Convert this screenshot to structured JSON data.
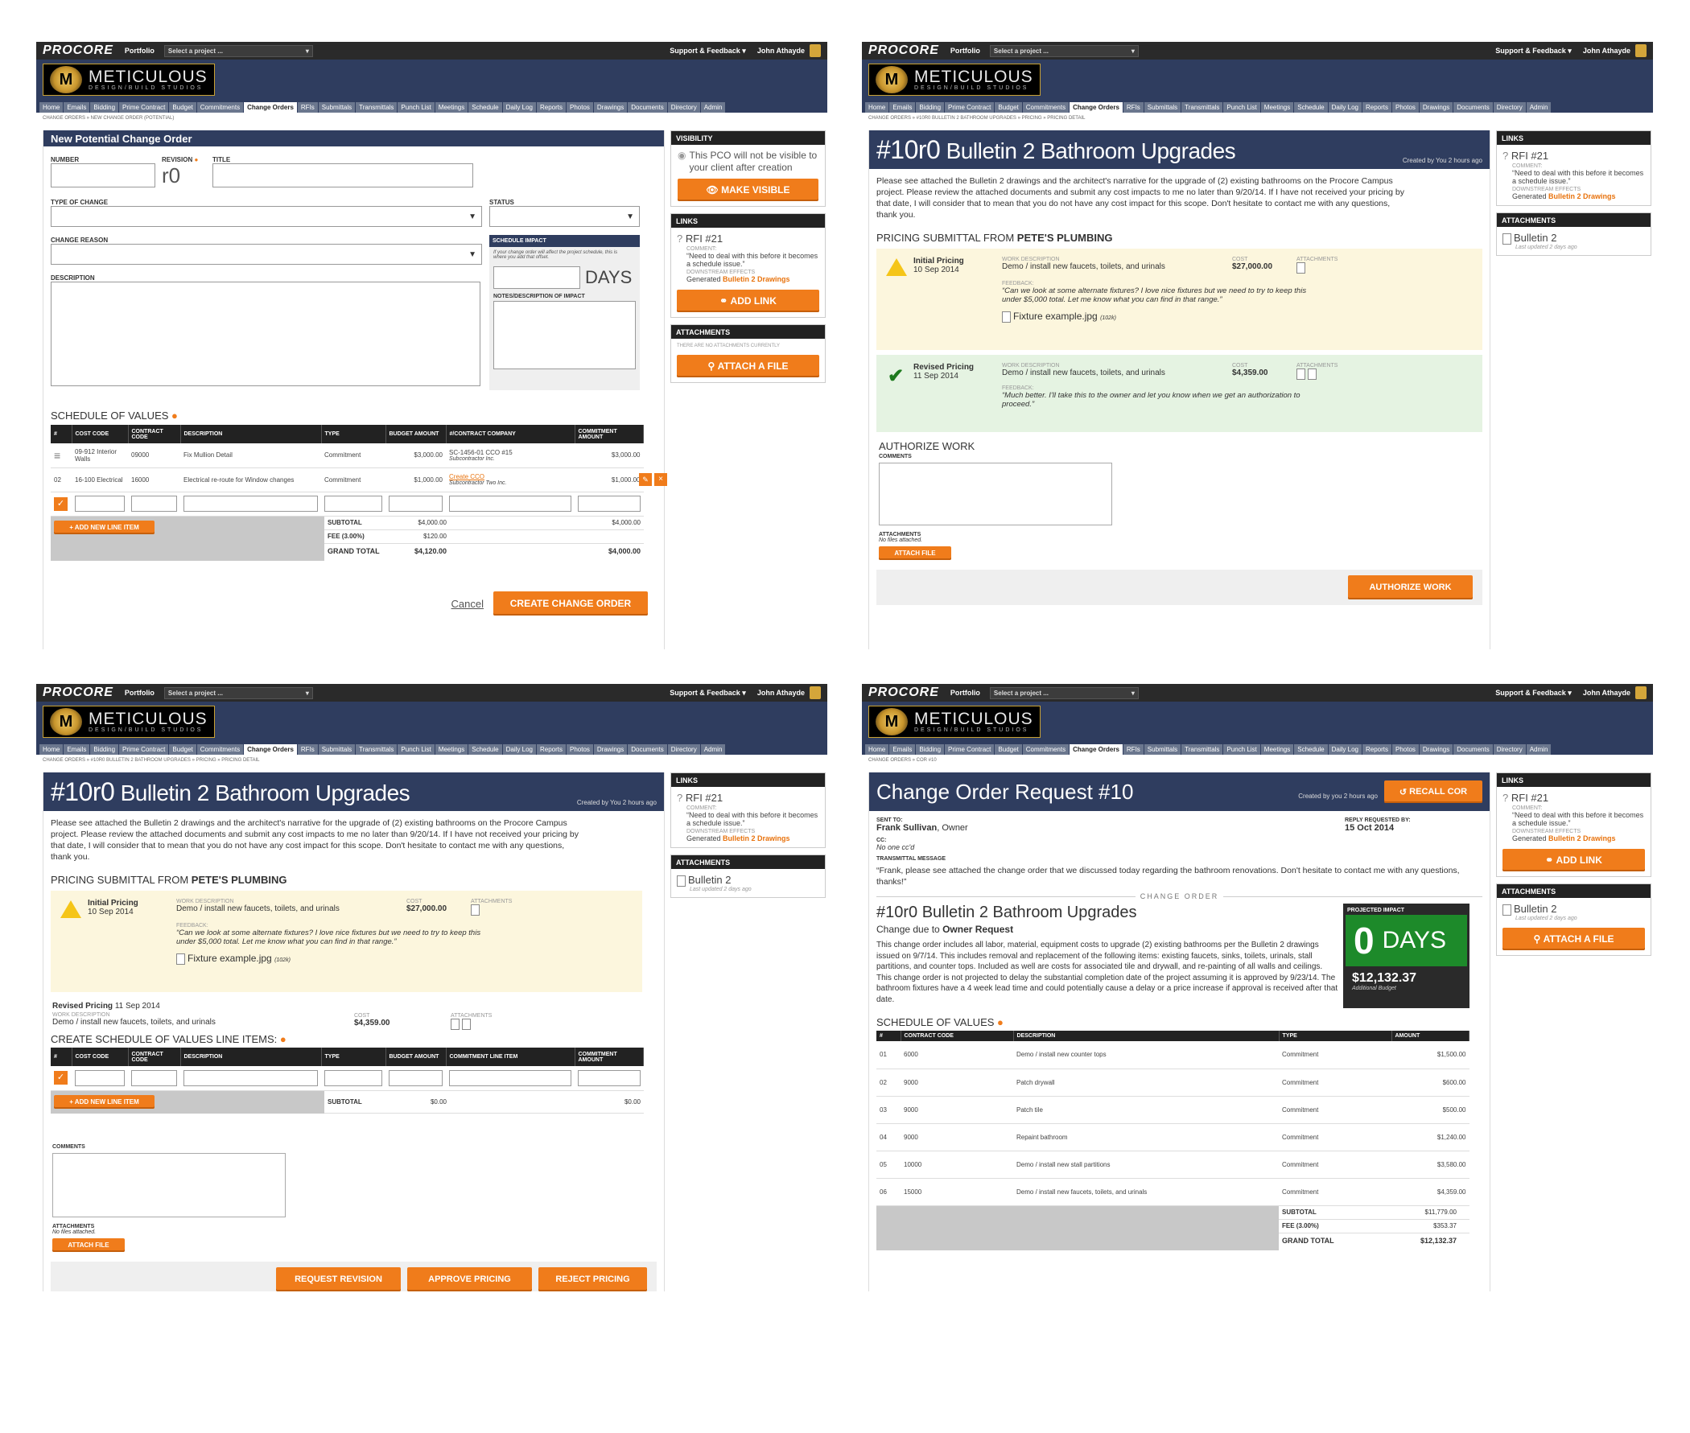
{
  "common": {
    "procore": "PROCORE",
    "portfolio": "Portfolio",
    "project_select": "Select a project ...",
    "support": "Support & Feedback ▾",
    "user": "John Athayde",
    "brand_name": "METICULOUS",
    "brand_sub": "DESIGN/BUILD STUDIOS",
    "nav": [
      "Home",
      "Emails",
      "Bidding",
      "Prime Contract",
      "Budget",
      "Commitments",
      "Change Orders",
      "RFIs",
      "Submittals",
      "Transmittals",
      "Punch List",
      "Meetings",
      "Schedule",
      "Daily Log",
      "Reports",
      "Photos",
      "Drawings",
      "Documents",
      "Directory",
      "Admin"
    ]
  },
  "s1": {
    "crumb": "CHANGE ORDERS » NEW CHANGE ORDER (POTENTIAL)",
    "title": "New Potential Change Order",
    "number_label": "NUMBER",
    "revision_label": "REVISION",
    "revision_value": "r0",
    "title_label": "TITLE",
    "type_label": "TYPE OF CHANGE",
    "status_label": "STATUS",
    "reason_label": "CHANGE REASON",
    "schedule_impact_label": "SCHEDULE IMPACT",
    "schedule_help": "If your change order will affect the project schedule, this is where you add that offset.",
    "days": "DAYS",
    "notes_label": "NOTES/DESCRIPTION OF IMPACT",
    "description_label": "DESCRIPTION",
    "sov_title": "SCHEDULE OF VALUES",
    "columns": [
      "#",
      "COST CODE",
      "CONTRACT CODE",
      "DESCRIPTION",
      "TYPE",
      "BUDGET AMOUNT",
      "#/CONTRACT COMPANY",
      "COMMITMENT AMOUNT"
    ],
    "rows": [
      {
        "num": "",
        "cost": "09-912 Interior Walls",
        "contract": "09000",
        "desc": "Fix Mullion Detail",
        "type": "Commitment",
        "budget": "$3,000.00",
        "company": "SC-1456-01 CCO #15",
        "company_sub": "Subcontractor Inc.",
        "commitment": "$3,000.00"
      },
      {
        "num": "02",
        "cost": "16-100 Electrical",
        "contract": "16000",
        "desc": "Electrical re-route for Window changes",
        "type": "Commitment",
        "budget": "$1,000.00",
        "company": "Create CCO",
        "company_sub": "Subcontractor Two Inc.",
        "commitment": "$1,000.00"
      }
    ],
    "add_line": "+ ADD NEW LINE ITEM",
    "subtotal_label": "SUBTOTAL",
    "subtotal": "$4,000.00",
    "fee_label": "FEE (3.00%)",
    "fee": "$120.00",
    "grand_label": "GRAND TOTAL",
    "grand": "$4,120.00",
    "commit_sub": "$4,000.00",
    "commit_grand": "$4,000.00",
    "cancel": "Cancel",
    "create": "CREATE CHANGE ORDER",
    "visibility_title": "VISIBILITY",
    "visibility_text": "This PCO will not be visible to your client after creation",
    "make_visible": "MAKE VISIBLE",
    "links_title": "LINKS",
    "rfi": "RFI #21",
    "comment_label": "COMMENT:",
    "comment": "“Need to deal with this before it becomes a schedule issue.”",
    "downstream": "DOWNSTREAM EFFECTS",
    "generated": "Generated",
    "bulletin_link": "Bulletin 2 Drawings",
    "add_link": "ADD LINK",
    "attachments_title": "ATTACHMENTS",
    "no_attach": "THERE ARE NO ATTACHMENTS CURRENTLY",
    "attach_file": "ATTACH A FILE"
  },
  "s2": {
    "crumb": "CHANGE ORDERS » #10R0 BULLETIN 2 BATHROOM UPGRADES » PRICING » PRICING DETAIL",
    "title_num": "#10r0",
    "title_text": "Bulletin 2 Bathroom Upgrades",
    "created": "Created by You 2 hours ago",
    "body": "Please see attached the Bulletin 2 drawings and the architect's narrative for the upgrade of (2) existing bathrooms on the Procore Campus project. Please review the attached documents and submit any cost impacts to me no later than 9/20/14. If I have not received your pricing by that date, I will consider that to mean that you do not have any cost impact for this scope. Don't hesitate to contact me with any questions, thank you.",
    "pricing_from": "PRICING SUBMITTAL FROM",
    "vendor": "PETE'S PLUMBING",
    "initial": "Initial Pricing",
    "initial_date": "10 Sep 2014",
    "work_label": "WORK DESCRIPTION",
    "work": "Demo / install new faucets, toilets, and urinals",
    "cost_label": "COST",
    "cost1": "$27,000.00",
    "attach_label": "ATTACHMENTS",
    "feedback_label": "FEEDBACK:",
    "feedback1": "“Can we look at some alternate fixtures? I love nice fixtures but we need to try to keep this under $5,000 total. Let me know what you can find in that range.”",
    "file1": "Fixture example.jpg",
    "file1_size": "(102k)",
    "revised": "Revised Pricing",
    "revised_date": "11 Sep 2014",
    "cost2": "$4,359.00",
    "feedback2": "“Much better. I'll take this to the owner and let you know when we get an authorization to proceed.”",
    "authorize_title": "AUTHORIZE WORK",
    "comments_label": "COMMENTS",
    "attachments_label": "ATTACHMENTS",
    "no_files": "No files attached.",
    "attach_file": "ATTACH FILE",
    "authorize_btn": "AUTHORIZE WORK",
    "links_title": "LINKS",
    "rfi": "RFI #21",
    "comment_label": "COMMENT:",
    "comment": "“Need to deal with this before it becomes a schedule issue.”",
    "downstream": "DOWNSTREAM EFFECTS",
    "generated": "Generated",
    "bulletin_link": "Bulletin 2 Drawings",
    "attachments_title": "ATTACHMENTS",
    "bulletin": "Bulletin 2",
    "last_updated": "Last updated 2 days ago"
  },
  "s3": {
    "crumb": "CHANGE ORDERS » #10R0 BULLETIN 2 BATHROOM UPGRADES » PRICING » PRICING DETAIL",
    "title_num": "#10r0",
    "title_text": "Bulletin 2 Bathroom Upgrades",
    "created": "Created by You 2 hours ago",
    "body": "Please see attached the Bulletin 2 drawings and the architect's narrative for the upgrade of (2) existing bathrooms on the Procore Campus project. Please review the attached documents and submit any cost impacts to me no later than 9/20/14. If I have not received your pricing by that date, I will consider that to mean that you do not have any cost impact for this scope. Don't hesitate to contact me with any questions, thank you.",
    "pricing_from": "PRICING SUBMITTAL FROM",
    "vendor": "PETE'S PLUMBING",
    "initial": "Initial Pricing",
    "initial_date": "10 Sep 2014",
    "work_label": "WORK DESCRIPTION",
    "work": "Demo / install new faucets, toilets, and urinals",
    "cost_label": "COST",
    "cost1": "$27,000.00",
    "attach_label": "ATTACHMENTS",
    "feedback_label": "FEEDBACK:",
    "feedback1": "“Can we look at some alternate fixtures? I love nice fixtures but we need to try to keep this under $5,000 total. Let me know what you can find in that range.”",
    "file1": "Fixture example.jpg",
    "file1_size": "(102k)",
    "revised": "Revised Pricing",
    "revised_date": "11 Sep 2014",
    "cost2": "$4,359.00",
    "create_sov": "CREATE SCHEDULE OF VALUES LINE ITEMS:",
    "columns": [
      "#",
      "COST CODE",
      "CONTRACT CODE",
      "DESCRIPTION",
      "TYPE",
      "BUDGET AMOUNT",
      "COMMITMENT LINE ITEM",
      "COMMITMENT AMOUNT"
    ],
    "add_line": "+ ADD NEW LINE ITEM",
    "subtotal_label": "SUBTOTAL",
    "subtotal": "$0.00",
    "commit_sub": "$0.00",
    "comments_label": "COMMENTS",
    "attachments_label": "ATTACHMENTS",
    "no_files": "No files attached.",
    "attach_file": "ATTACH FILE",
    "request_revision": "REQUEST REVISION",
    "approve": "APPROVE PRICING",
    "reject": "REJECT PRICING",
    "links_title": "LINKS",
    "rfi": "RFI #21",
    "comment_label": "COMMENT:",
    "comment": "“Need to deal with this before it becomes a schedule issue.”",
    "downstream": "DOWNSTREAM EFFECTS",
    "generated": "Generated",
    "bulletin_link": "Bulletin 2 Drawings",
    "attachments_title": "ATTACHMENTS",
    "bulletin": "Bulletin 2",
    "last_updated": "Last updated 2 days ago"
  },
  "s4": {
    "crumb": "CHANGE ORDERS » COR #10",
    "title": "Change Order Request #10",
    "created": "Created by you 2 hours ago",
    "recall": "RECALL COR",
    "sent_to_label": "SENT TO:",
    "sent_to_name": "Frank Sullivan",
    "sent_to_role": ", Owner",
    "reply_label": "REPLY REQUESTED BY:",
    "reply_date": "15 Oct 2014",
    "cc_label": "CC:",
    "cc": "No one cc'd",
    "transmittal_label": "TRANSMITTAL MESSAGE",
    "transmittal": "“Frank, please see attached the change order that we discussed today regarding the bathroom renovations. Don't hesitate to contact me with any questions, thanks!”",
    "change_order_divider": "CHANGE ORDER",
    "co_title": "#10r0 Bulletin 2 Bathroom Upgrades",
    "change_due": "Change due to",
    "change_reason": "Owner Request",
    "co_body": "This change order includes all labor, material, equipment costs to upgrade (2) existing bathrooms per the Bulletin 2 drawings issued on 9/7/14. This includes removal and replacement of the following items: existing faucets, sinks, toilets, urinals, stall partitions, and counter tops. Included as well are costs for associated tile and drywall, and re-painting of all walls and ceilings. This change order is not projected to delay the substantial completion date of the project assuming it is approved by 9/23/14. The bathroom fixtures have a 4 week lead time and could potentially cause a delay or a price increase if approval is received after that date.",
    "impact_label": "PROJECTED IMPACT",
    "impact_days": "0",
    "days": "DAYS",
    "impact_amount": "$12,132.37",
    "additional_budget": "Additional Budget",
    "sov_title": "SCHEDULE OF VALUES",
    "columns": [
      "#",
      "CONTRACT CODE",
      "DESCRIPTION",
      "TYPE",
      "AMOUNT"
    ],
    "rows": [
      {
        "num": "01",
        "code": "6000",
        "desc": "Demo / install new counter tops",
        "type": "Commitment",
        "amount": "$1,500.00"
      },
      {
        "num": "02",
        "code": "9000",
        "desc": "Patch drywall",
        "type": "Commitment",
        "amount": "$600.00"
      },
      {
        "num": "03",
        "code": "9000",
        "desc": "Patch tile",
        "type": "Commitment",
        "amount": "$500.00"
      },
      {
        "num": "04",
        "code": "9000",
        "desc": "Repaint bathroom",
        "type": "Commitment",
        "amount": "$1,240.00"
      },
      {
        "num": "05",
        "code": "10000",
        "desc": "Demo / install new stall partitions",
        "type": "Commitment",
        "amount": "$3,580.00"
      },
      {
        "num": "06",
        "code": "15000",
        "desc": "Demo / install new faucets, toilets, and urinals",
        "type": "Commitment",
        "amount": "$4,359.00"
      }
    ],
    "subtotal_label": "SUBTOTAL",
    "subtotal": "$11,779.00",
    "fee_label": "FEE (3.00%)",
    "fee": "$353.37",
    "grand_label": "GRAND TOTAL",
    "grand": "$12,132.37",
    "links_title": "LINKS",
    "rfi": "RFI #21",
    "comment_label": "COMMENT:",
    "comment": "“Need to deal with this before it becomes a schedule issue.”",
    "downstream": "DOWNSTREAM EFFECTS",
    "generated": "Generated",
    "bulletin_link": "Bulletin 2 Drawings",
    "add_link": "ADD LINK",
    "attachments_title": "ATTACHMENTS",
    "bulletin": "Bulletin 2",
    "last_updated": "Last updated 2 days ago",
    "attach_file": "ATTACH A FILE"
  },
  "colors": {
    "navy": "#2f3d5f",
    "orange": "#f07c1b",
    "green": "#1d7a1d",
    "yellow_bg": "#fcf6dd",
    "green_bg": "#e5f3e2"
  }
}
